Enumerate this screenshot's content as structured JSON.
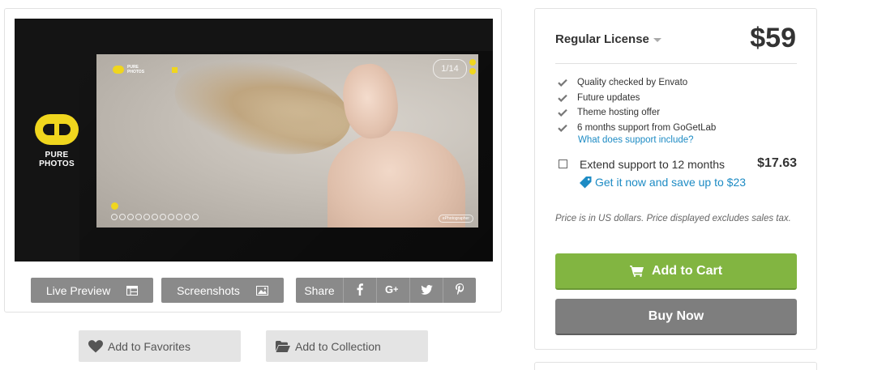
{
  "preview": {
    "brand_line1": "PURE",
    "brand_line2": "PHOTOS",
    "counter": "1/14",
    "credit": "ePhotographer"
  },
  "actions": {
    "live_preview": "Live Preview",
    "screenshots": "Screenshots",
    "share": "Share",
    "share_icons": [
      "facebook-icon",
      "google-plus-icon",
      "twitter-icon",
      "pinterest-icon"
    ],
    "add_to_favorites": "Add to Favorites",
    "add_to_collection": "Add to Collection"
  },
  "license": {
    "title": "Regular License",
    "price": "$59",
    "features": [
      "Quality checked by Envato",
      "Future updates",
      "Theme hosting offer",
      "6 months support from GoGetLab"
    ],
    "support_link": "What does support include?",
    "extend_label": "Extend support to 12 months",
    "extend_price": "$17.63",
    "extend_checked": false,
    "save_link": "Get it now and save up to $23",
    "note": "Price is in US dollars. Price displayed excludes sales tax.",
    "add_to_cart": "Add to Cart",
    "buy_now": "Buy Now"
  },
  "colors": {
    "accent_green": "#82b541",
    "link_blue": "#1d8bc4",
    "button_gray": "#8a8a8a",
    "brand_yellow": "#f0d61e"
  }
}
